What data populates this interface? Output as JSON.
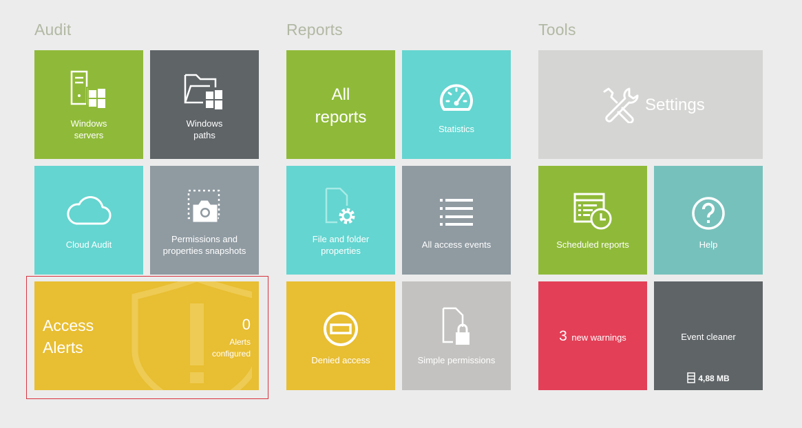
{
  "sections": {
    "audit": "Audit",
    "reports": "Reports",
    "tools": "Tools"
  },
  "audit": {
    "windows_servers": [
      "Windows",
      "servers"
    ],
    "windows_paths": [
      "Windows",
      "paths"
    ],
    "cloud_audit": "Cloud Audit",
    "snapshots": [
      "Permissions and",
      "properties snapshots"
    ],
    "access_alerts": {
      "title": [
        "Access",
        "Alerts"
      ],
      "count": "0",
      "caption": [
        "Alerts",
        "configured"
      ]
    }
  },
  "reports": {
    "all_reports": [
      "All",
      "reports"
    ],
    "statistics": "Statistics",
    "file_folder": [
      "File and folder",
      "properties"
    ],
    "all_access_events": "All access events",
    "denied_access": "Denied access",
    "simple_permissions": "Simple permissions"
  },
  "tools": {
    "settings": "Settings",
    "scheduled_reports": "Scheduled reports",
    "help": "Help",
    "warnings": {
      "count": "3",
      "label": "new warnings"
    },
    "event_cleaner": {
      "label": "Event cleaner",
      "size": "4,88 MB"
    }
  },
  "colors": {
    "green": "#8fba39",
    "dark_gray": "#5f6467",
    "teal": "#64d5d0",
    "slate": "#8f9aa1",
    "light_gray": "#c3c2c0",
    "yellow": "#e8be32",
    "settings_gray": "#d5d5d3",
    "sage": "#77c1bc",
    "red": "#e33f57",
    "highlight_border": "#d8323f"
  }
}
